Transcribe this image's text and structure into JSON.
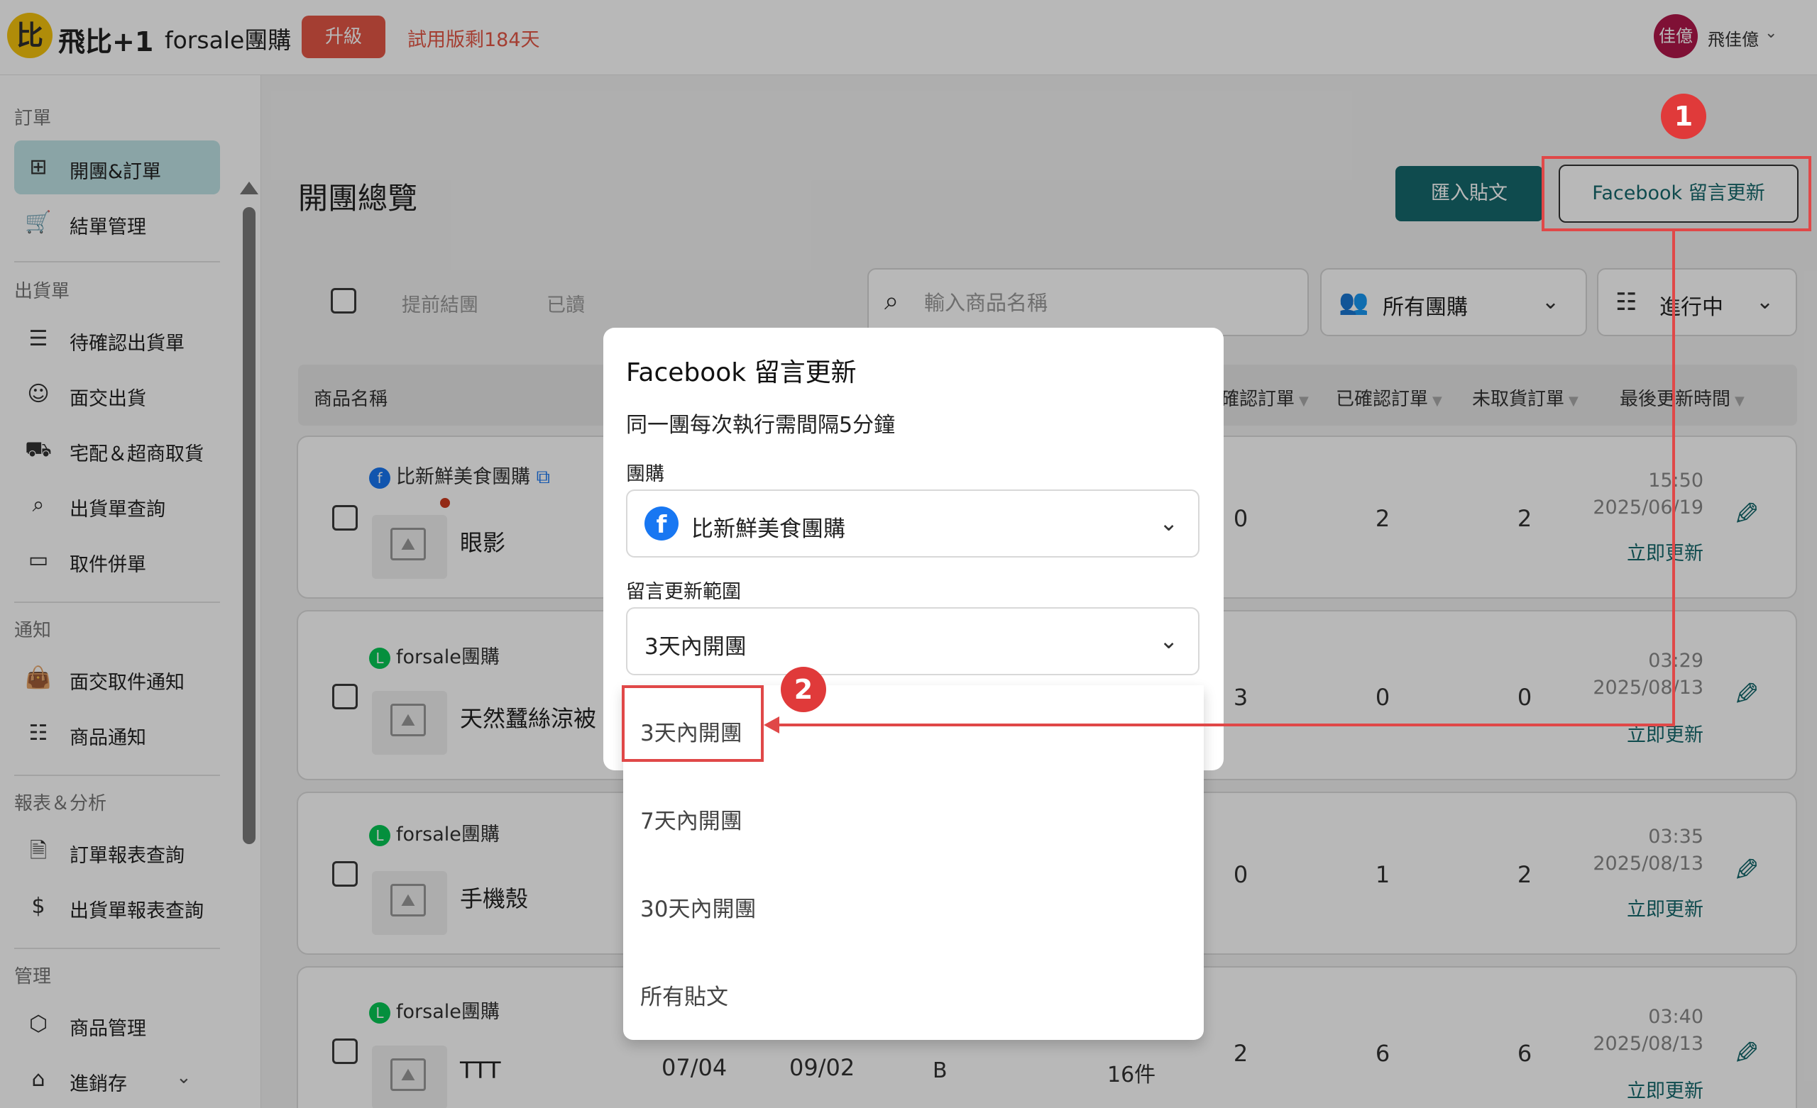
{
  "header": {
    "logo_glyph": "比",
    "brand": "飛比+1",
    "store": "forsale團購",
    "upgrade": "升級",
    "trial": "試用版剩184天",
    "avatar": "佳億",
    "user": "飛佳億",
    "chevron": "⌄"
  },
  "sidebar": {
    "sections": [
      {
        "label": "訂單",
        "items": [
          {
            "label": "開團&訂單",
            "icon": "group-order-icon",
            "glyph": "⊞",
            "active": true
          },
          {
            "label": "結單管理",
            "icon": "cart-icon",
            "glyph": "🛒"
          }
        ]
      },
      {
        "label": "出貨單",
        "items": [
          {
            "label": "待確認出貨單",
            "icon": "list-icon",
            "glyph": "☰"
          },
          {
            "label": "面交出貨",
            "icon": "smile-icon",
            "glyph": "☺"
          },
          {
            "label": "宅配＆超商取貨",
            "icon": "truck-icon",
            "glyph": "⛟"
          },
          {
            "label": "出貨單查詢",
            "icon": "search-icon",
            "glyph": "⌕"
          },
          {
            "label": "取件併單",
            "icon": "box-icon",
            "glyph": "▭"
          }
        ]
      },
      {
        "label": "通知",
        "items": [
          {
            "label": "面交取件通知",
            "icon": "bag-icon",
            "glyph": "👜"
          },
          {
            "label": "商品通知",
            "icon": "sliders-icon",
            "glyph": "☷"
          }
        ]
      },
      {
        "label": "報表＆分析",
        "items": [
          {
            "label": "訂單報表查詢",
            "icon": "report-icon",
            "glyph": "🗎"
          },
          {
            "label": "出貨單報表查詢",
            "icon": "dollar-report-icon",
            "glyph": "$"
          }
        ]
      },
      {
        "label": "管理",
        "items": [
          {
            "label": "商品管理",
            "icon": "cube-icon",
            "glyph": "⬡"
          },
          {
            "label": "進銷存",
            "icon": "warehouse-icon",
            "glyph": "⌂",
            "expandable": true
          }
        ]
      }
    ]
  },
  "main": {
    "title": "開團總覽",
    "import_btn": "匯入貼文",
    "fb_update_btn": "Facebook 留言更新",
    "toolbar": {
      "early_close": "提前結團",
      "read": "已讀"
    },
    "search": {
      "placeholder": "輸入商品名稱"
    },
    "filter_group": "所有團購",
    "filter_status": "進行中",
    "columns": [
      "商品名稱",
      "確認訂單",
      "已確認訂單",
      "未取貨訂單",
      "最後更新時間"
    ],
    "rows": [
      {
        "group": "比新鮮美食團購",
        "group_type": "fb",
        "name": "眼影",
        "n1": "0",
        "n2": "2",
        "n3": "2",
        "time": "15:50",
        "date": "2025/06/19",
        "refresh": "立即更新",
        "dot": true
      },
      {
        "group": "forsale團購",
        "group_type": "line",
        "name": "天然蠶絲涼被",
        "n1": "3",
        "n2": "0",
        "n3": "0",
        "time": "03:29",
        "date": "2025/08/13",
        "refresh": "立即更新"
      },
      {
        "group": "forsale團購",
        "group_type": "line",
        "name": "手機殼",
        "n1": "0",
        "n2": "1",
        "n3": "2",
        "time": "03:35",
        "date": "2025/08/13",
        "refresh": "立即更新"
      },
      {
        "group": "forsale團購",
        "group_type": "line",
        "name": "TTT",
        "n1": "2",
        "n2": "6",
        "n3": "6",
        "time": "03:40",
        "date": "2025/08/13",
        "refresh": "立即更新",
        "start": "07/04",
        "end": "09/02",
        "spec": "B",
        "qty": "16件"
      }
    ]
  },
  "modal": {
    "title": "Facebook 留言更新",
    "desc": "同一團每次執行需間隔5分鐘",
    "group_label": "團購",
    "group_value": "比新鮮美食團購",
    "range_label": "留言更新範圍",
    "range_value": "3天內開團",
    "options": [
      "3天內開團",
      "7天內開團",
      "30天內開團",
      "所有貼文"
    ]
  },
  "annotations": {
    "step1": "1",
    "step2": "2"
  },
  "colors": {
    "accent": "#16696c",
    "upgrade": "#e45646",
    "annotation": "#e04848",
    "facebook": "#1877f2",
    "line": "#06c755"
  }
}
